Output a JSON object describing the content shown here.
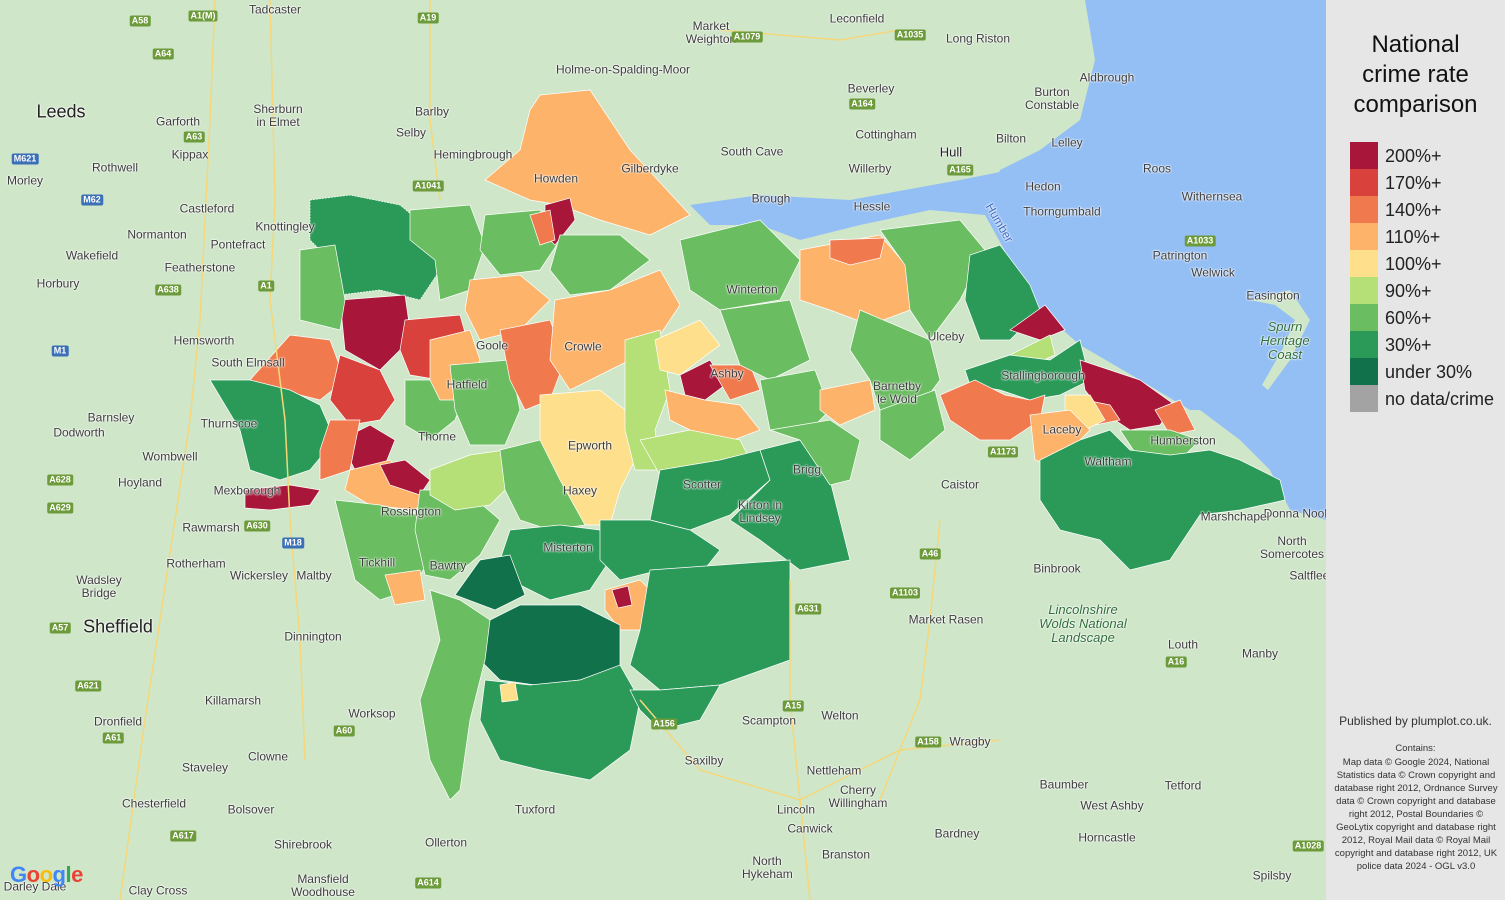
{
  "legend": {
    "title": "National crime rate comparison",
    "items": [
      {
        "label": "200%+",
        "color": "#a8163a"
      },
      {
        "label": "170%+",
        "color": "#d9413c"
      },
      {
        "label": "140%+",
        "color": "#f07a4e"
      },
      {
        "label": "110%+",
        "color": "#fdb36a"
      },
      {
        "label": "100%+",
        "color": "#fddf8c"
      },
      {
        "label": "90%+",
        "color": "#b5df77"
      },
      {
        "label": "60%+",
        "color": "#6bbd62"
      },
      {
        "label": "30%+",
        "color": "#2b9a58"
      },
      {
        "label": "under 30%",
        "color": "#11714a"
      },
      {
        "label": "no data/crime",
        "color": "#a3a3a3"
      }
    ]
  },
  "credits": {
    "published": "Published by plumplot.co.uk.",
    "contains_title": "Contains:",
    "contains_text": "Map data © Google 2024, National Statistics data © Crown copyright and database right 2012, Ordnance Survey data © Crown copyright and database right 2012, Postal Boundaries © GeoLytix copyright and database right 2012, Royal Mail data © Royal Mail copyright and database right 2012, UK police data 2024 - OGL v3.0"
  },
  "map": {
    "google_logo": "Google",
    "places": [
      {
        "name": "Leeds",
        "big": true
      },
      {
        "name": "Sheffield",
        "big": true
      },
      {
        "name": "Hull"
      },
      {
        "name": "Tadcaster"
      },
      {
        "name": "Garforth"
      },
      {
        "name": "Kippax"
      },
      {
        "name": "Rothwell"
      },
      {
        "name": "Morley"
      },
      {
        "name": "Castleford"
      },
      {
        "name": "Normanton"
      },
      {
        "name": "Wakefield"
      },
      {
        "name": "Pontefract"
      },
      {
        "name": "Knottingley"
      },
      {
        "name": "Featherstone"
      },
      {
        "name": "Horbury"
      },
      {
        "name": "Hemsworth"
      },
      {
        "name": "South Elmsall"
      },
      {
        "name": "Barnsley"
      },
      {
        "name": "Dodworth"
      },
      {
        "name": "Thurnscoe"
      },
      {
        "name": "Wombwell"
      },
      {
        "name": "Hoyland"
      },
      {
        "name": "Mexborough"
      },
      {
        "name": "Rawmarsh"
      },
      {
        "name": "Rotherham"
      },
      {
        "name": "Wickersley"
      },
      {
        "name": "Maltby"
      },
      {
        "name": "Wadsley Bridge"
      },
      {
        "name": "Dinnington"
      },
      {
        "name": "Killamarsh"
      },
      {
        "name": "Worksop"
      },
      {
        "name": "Dronfield"
      },
      {
        "name": "Clowne"
      },
      {
        "name": "Staveley"
      },
      {
        "name": "Chesterfield"
      },
      {
        "name": "Bolsover"
      },
      {
        "name": "Shirebrook"
      },
      {
        "name": "Mansfield Woodhouse"
      },
      {
        "name": "Clay Cross"
      },
      {
        "name": "Darley Dale"
      },
      {
        "name": "Ollerton"
      },
      {
        "name": "Tuxford"
      },
      {
        "name": "Saxilby"
      },
      {
        "name": "Lincoln"
      },
      {
        "name": "North Hykeham"
      },
      {
        "name": "Canwick"
      },
      {
        "name": "Branston"
      },
      {
        "name": "Cherry Willingham"
      },
      {
        "name": "Nettleham"
      },
      {
        "name": "Welton"
      },
      {
        "name": "Scampton"
      },
      {
        "name": "Bardney"
      },
      {
        "name": "Wragby"
      },
      {
        "name": "Baumber"
      },
      {
        "name": "West Ashby"
      },
      {
        "name": "Horncastle"
      },
      {
        "name": "Tetford"
      },
      {
        "name": "Spilsby"
      },
      {
        "name": "Louth"
      },
      {
        "name": "Manby"
      },
      {
        "name": "Saltfleet"
      },
      {
        "name": "North Somercotes"
      },
      {
        "name": "Donna Nook"
      },
      {
        "name": "Binbrook"
      },
      {
        "name": "Market Rasen"
      },
      {
        "name": "Caistor"
      },
      {
        "name": "Selby"
      },
      {
        "name": "Barlby"
      },
      {
        "name": "Sherburn in Elmet"
      },
      {
        "name": "Hemingbrough"
      },
      {
        "name": "Market Weighton"
      },
      {
        "name": "Holme-on-Spalding-Moor"
      },
      {
        "name": "Leconfield"
      },
      {
        "name": "Beverley"
      },
      {
        "name": "Long Riston"
      },
      {
        "name": "Aldbrough"
      },
      {
        "name": "Burton Constable"
      },
      {
        "name": "Bilton"
      },
      {
        "name": "Lelley"
      },
      {
        "name": "Roos"
      },
      {
        "name": "Hedon"
      },
      {
        "name": "Withernsea"
      },
      {
        "name": "Thorngumbald"
      },
      {
        "name": "Patrington"
      },
      {
        "name": "Welwick"
      },
      {
        "name": "Easington"
      },
      {
        "name": "Cottingham"
      },
      {
        "name": "Willerby"
      },
      {
        "name": "Hessle"
      },
      {
        "name": "South Cave"
      },
      {
        "name": "Brough"
      },
      {
        "name": "Gilberdyke"
      },
      {
        "name": "Howden"
      },
      {
        "name": "Epworth"
      },
      {
        "name": "Haxey"
      },
      {
        "name": "Misterton"
      },
      {
        "name": "Scotter"
      },
      {
        "name": "Kirton in Lindsey"
      },
      {
        "name": "Winterton"
      },
      {
        "name": "Ulceby"
      },
      {
        "name": "Barnetby le Wold"
      },
      {
        "name": "Brigg"
      },
      {
        "name": "Crowle"
      },
      {
        "name": "Tickhill"
      },
      {
        "name": "Bawtry"
      },
      {
        "name": "Rossington"
      },
      {
        "name": "Waltham"
      },
      {
        "name": "Humberston"
      },
      {
        "name": "Marshchapel"
      },
      {
        "name": "Laceby"
      },
      {
        "name": "Stallingborough"
      },
      {
        "name": "Ashby"
      },
      {
        "name": "Goole"
      },
      {
        "name": "Hatfield"
      },
      {
        "name": "Thorne"
      }
    ],
    "parks": [
      "Lincolnshire Wolds National Landscape",
      "Spurn Heritage Coast"
    ],
    "water": [
      "Humber"
    ],
    "roads": [
      "A58",
      "A1(M)",
      "A64",
      "A19",
      "A63",
      "A1079",
      "A1035",
      "M621",
      "M62",
      "A1041",
      "A638",
      "A1",
      "M1",
      "A628",
      "A629",
      "A630",
      "M18",
      "A57",
      "A621",
      "A61",
      "A617",
      "A614",
      "A60",
      "A156",
      "A15",
      "A46",
      "A631",
      "A1103",
      "A158",
      "A16",
      "A1028",
      "A165",
      "A1033",
      "A1173",
      "A164"
    ]
  }
}
